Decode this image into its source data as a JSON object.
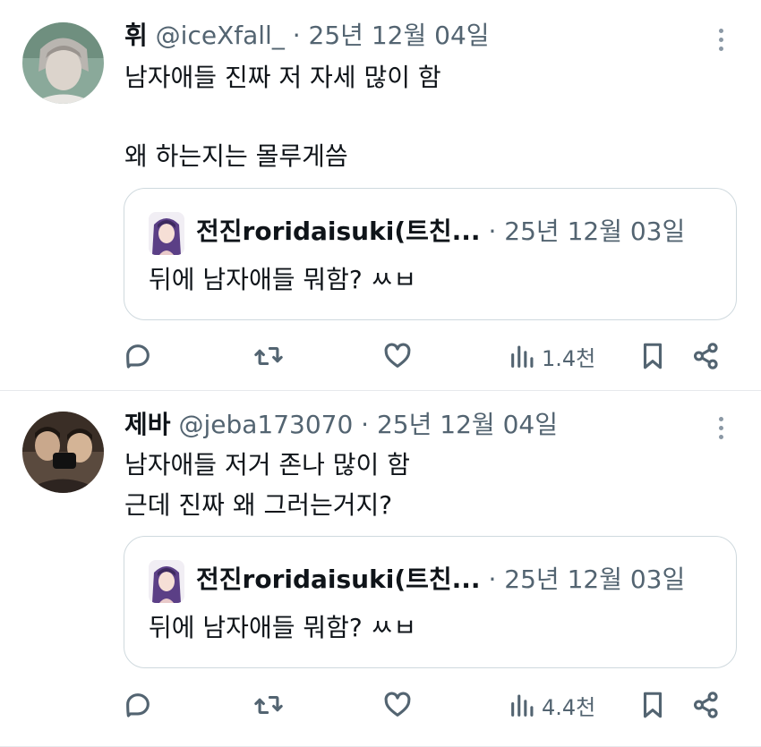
{
  "tweets": [
    {
      "name": "휘",
      "handle": "@iceXfall_",
      "separator": "·",
      "date": "25년 12월 04일",
      "lines": [
        "남자애들 진짜 저 자세 많이 함",
        "왜 하는지는 몰루게씀"
      ],
      "quote": {
        "name": "전진roridaisuki(트친...",
        "separator": "·",
        "date": "25년 12월 03일",
        "text": "뒤에 남자애들 뭐함? ㅆㅂ"
      },
      "views": "1.4천"
    },
    {
      "name": "제바",
      "handle": "@jeba173070",
      "separator": "·",
      "date": "25년 12월 04일",
      "lines": [
        "남자애들 저거 존나 많이 함",
        "근데 진짜 왜 그러는거지?"
      ],
      "quote": {
        "name": "전진roridaisuki(트친...",
        "separator": "·",
        "date": "25년 12월 03일",
        "text": "뒤에 남자애들 뭐함? ㅆㅂ"
      },
      "views": "4.4천"
    }
  ],
  "icons": {
    "reply": "reply-icon",
    "retweet": "retweet-icon",
    "like": "heart-icon",
    "views": "views-chart-icon",
    "bookmark": "bookmark-icon",
    "share": "share-icon",
    "more": "more-options-icon"
  },
  "colors": {
    "text": "#0f1419",
    "secondary": "#536471",
    "border": "#cfd9de"
  }
}
